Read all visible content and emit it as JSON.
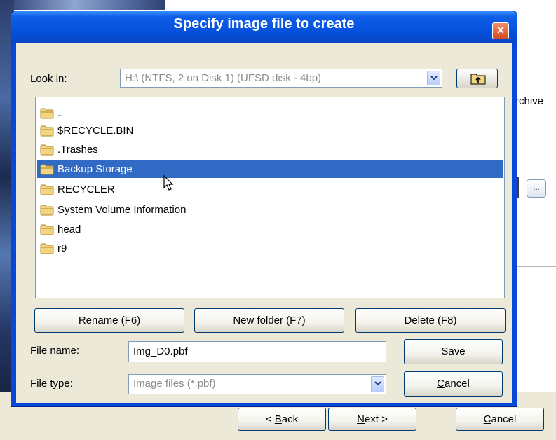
{
  "background": {
    "archive_fragment": "rchive",
    "browse_label": "...",
    "back_label": "< Back",
    "back_key": "B",
    "next_label": "Next >",
    "next_key": "N",
    "cancel_label": "Cancel",
    "cancel_key": "C"
  },
  "dialog": {
    "title": "Specify image file to create",
    "close_label": "×",
    "look_in_label": "Look in:",
    "look_in_value": "H:\\  (NTFS, 2 on Disk 1) (UFSD disk - 4bp)",
    "files": [
      {
        "name": "..",
        "selected": false
      },
      {
        "name": "$RECYCLE.BIN",
        "selected": false
      },
      {
        "name": ".Trashes",
        "selected": false
      },
      {
        "name": "Backup Storage",
        "selected": true
      },
      {
        "name": "RECYCLER",
        "selected": false
      },
      {
        "name": "System Volume Information",
        "selected": false
      },
      {
        "name": "head",
        "selected": false
      },
      {
        "name": "r9",
        "selected": false
      }
    ],
    "rename_label": "Rename (F6)",
    "new_folder_label": "New folder (F7)",
    "delete_label": "Delete (F8)",
    "file_name_label": "File name:",
    "file_name_value": "Img_D0.pbf",
    "save_label": "Save",
    "file_type_label": "File type:",
    "file_type_value": "Image files (*.pbf)",
    "cancel_rest": "ancel",
    "cancel_key": "C"
  },
  "colors": {
    "title_bar": "#0754e0",
    "selection": "#316ac5",
    "close_button": "#d94a21",
    "folder": "#f3d481"
  },
  "icons": {
    "folder": "folder-icon",
    "up_folder": "up-folder-icon",
    "close": "close-icon",
    "dropdown": "chevron-down-icon",
    "cursor": "mouse-cursor-icon"
  }
}
